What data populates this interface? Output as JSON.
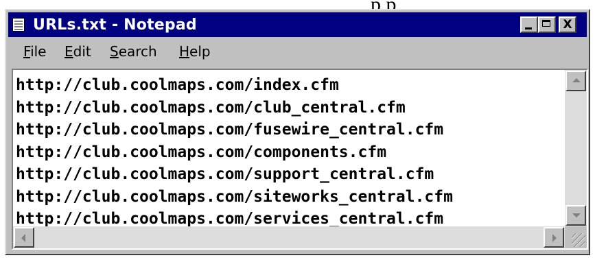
{
  "window": {
    "title": "URLs.txt - Notepad",
    "controls": {
      "minimize_icon": "minimize-icon",
      "maximize_icon": "maximize-icon",
      "close_label": "X"
    }
  },
  "menu": [
    {
      "acc": "F",
      "rest": "ile"
    },
    {
      "acc": "E",
      "rest": "dit"
    },
    {
      "acc": "S",
      "rest": "earch"
    },
    {
      "acc": "H",
      "rest": "elp"
    }
  ],
  "document": {
    "lines": [
      "http://club.coolmaps.com/index.cfm",
      "http://club.coolmaps.com/club_central.cfm",
      "http://club.coolmaps.com/fusewire_central.cfm",
      "http://club.coolmaps.com/components.cfm",
      "http://club.coolmaps.com/support_central.cfm",
      "http://club.coolmaps.com/siteworks_central.cfm",
      "http://club.coolmaps.com/services_central.cfm"
    ]
  },
  "colors": {
    "titlebar": "#000080",
    "window": "#c0c0c0",
    "editor_bg": "#ffffff"
  }
}
